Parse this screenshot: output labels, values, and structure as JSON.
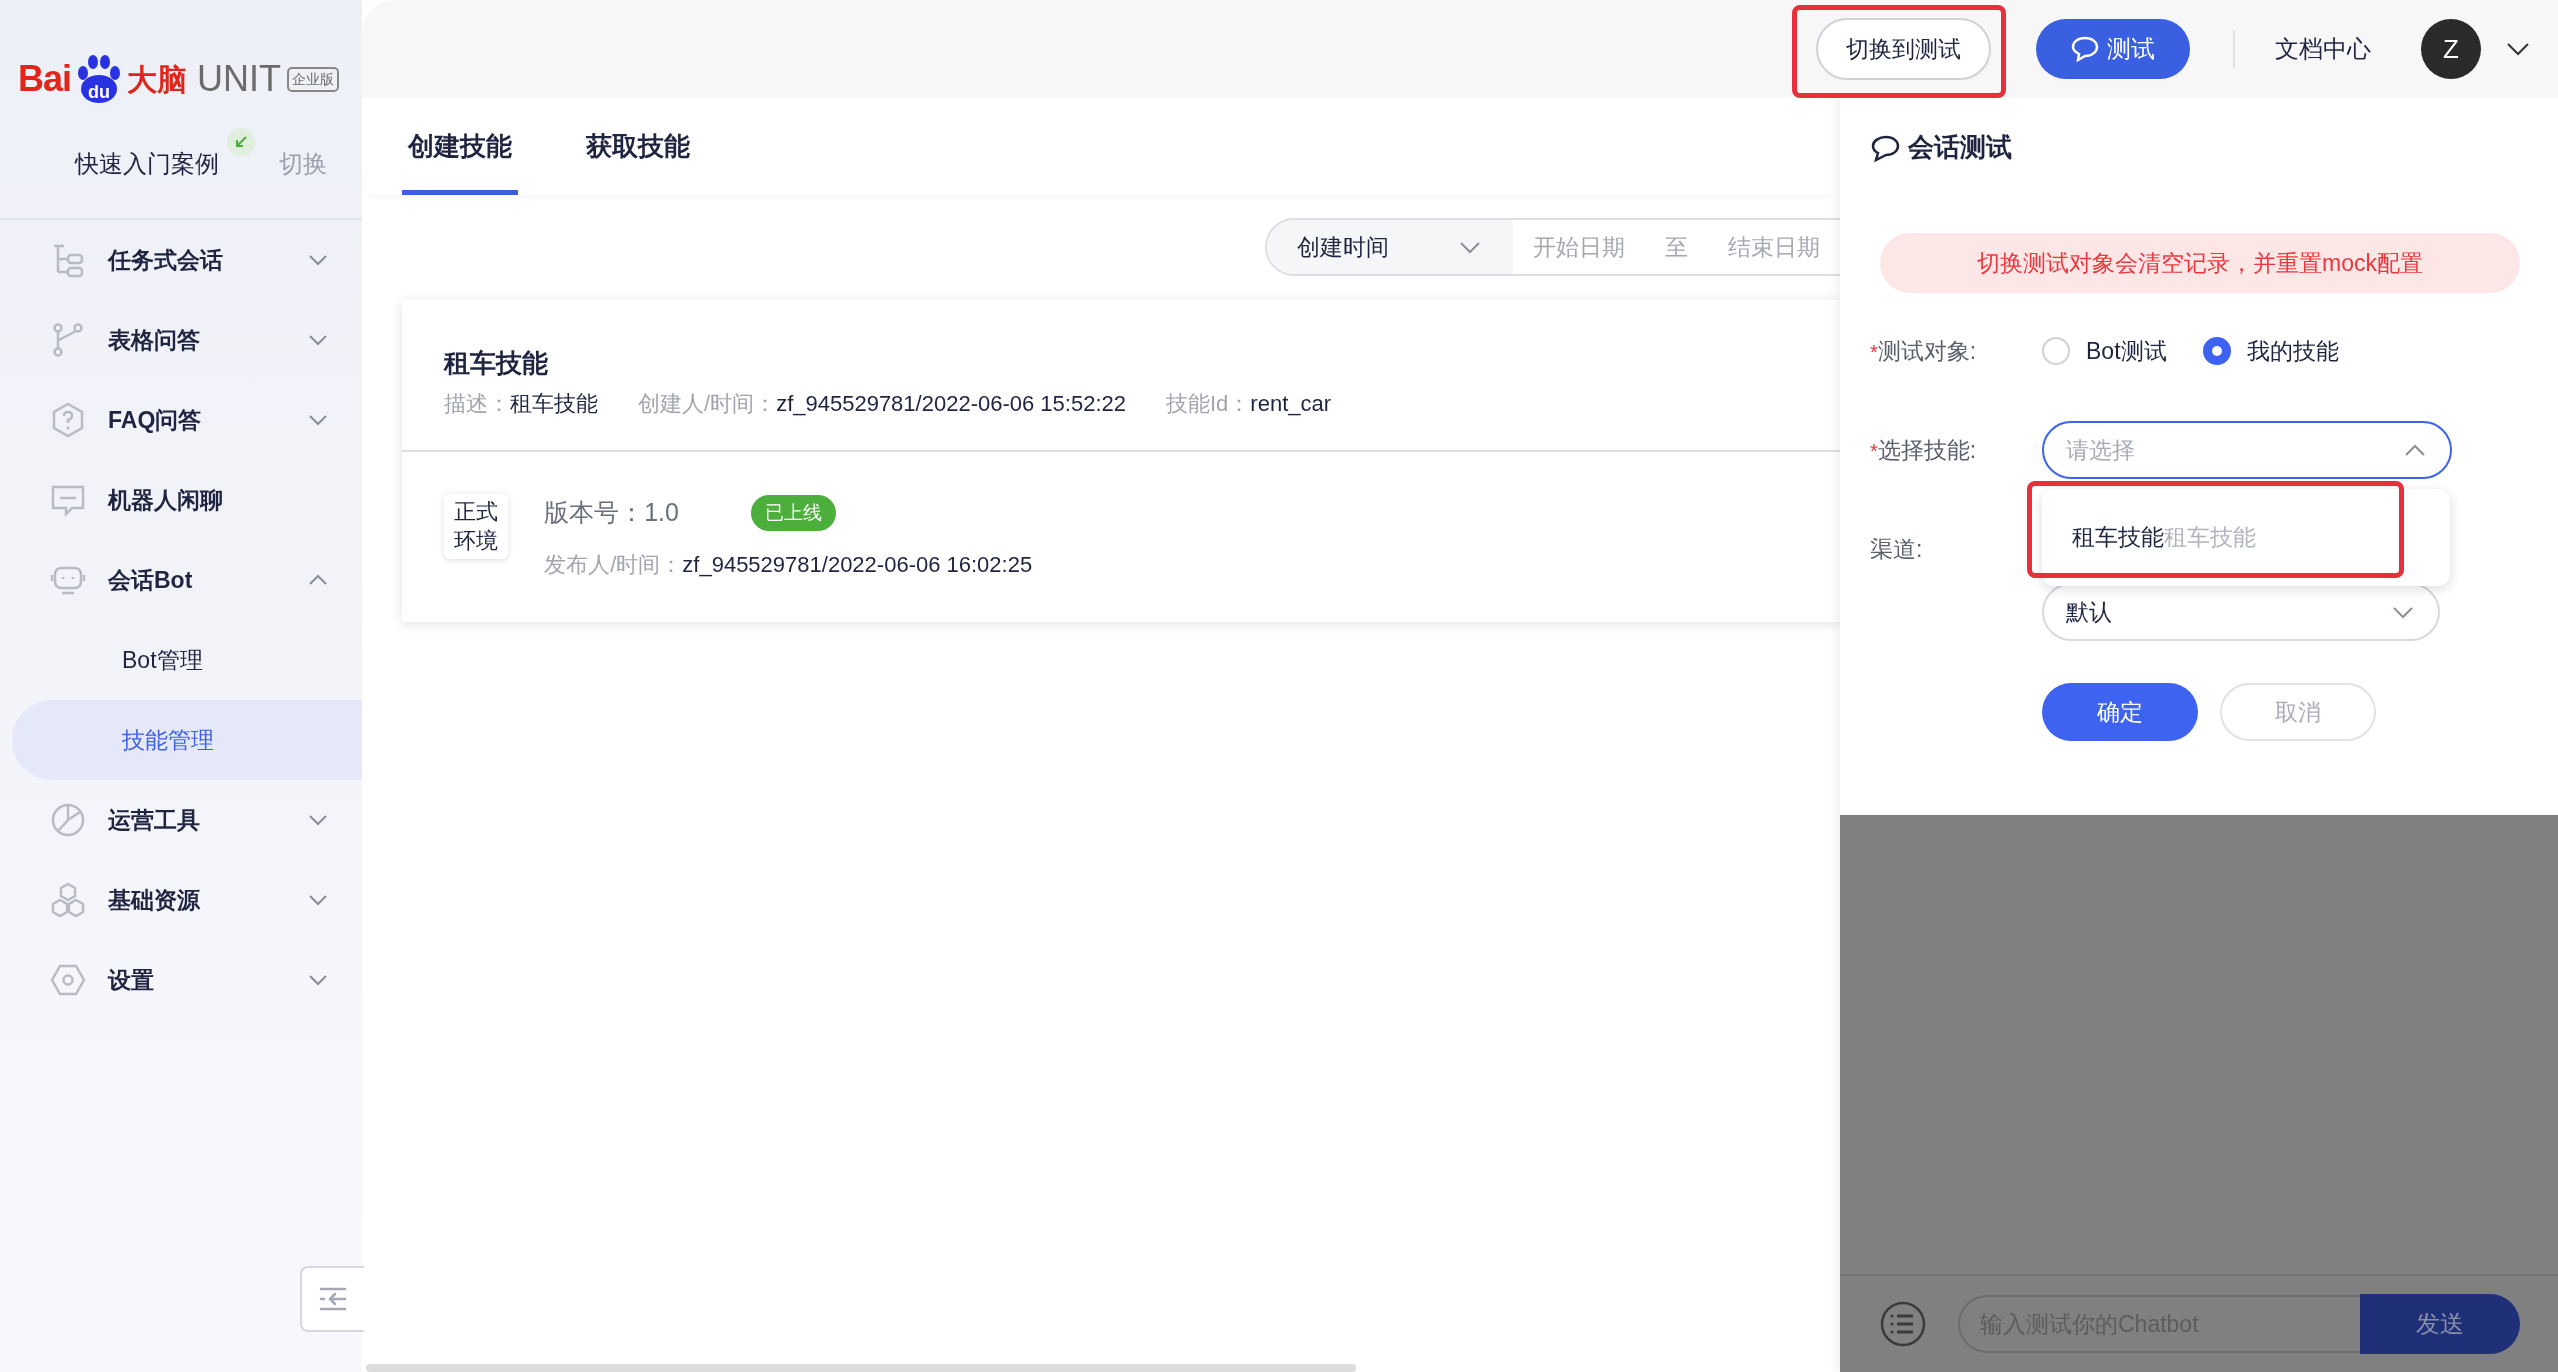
{
  "logo": {
    "bai": "Bai",
    "du": "du",
    "dana": "大脑",
    "unit": "UNIT",
    "edition": "企业版"
  },
  "quickstart": {
    "label": "快速入门案例",
    "switch": "切换"
  },
  "sidebar": {
    "items": [
      {
        "label": "任务式会话",
        "expanded": false
      },
      {
        "label": "表格问答",
        "expanded": false
      },
      {
        "label": "FAQ问答",
        "expanded": false
      },
      {
        "label": "机器人闲聊"
      },
      {
        "label": "会话Bot",
        "expanded": true,
        "children": [
          {
            "label": "Bot管理",
            "selected": false
          },
          {
            "label": "技能管理",
            "selected": true
          }
        ]
      },
      {
        "label": "运营工具",
        "expanded": false
      },
      {
        "label": "基础资源",
        "expanded": false
      },
      {
        "label": "设置",
        "expanded": false
      }
    ]
  },
  "header": {
    "switch_button": {
      "label": "切换到测试",
      "highlighted": true
    },
    "test_button": "测试",
    "docs": "文档中心",
    "avatar": "Z"
  },
  "tabs": [
    {
      "label": "创建技能",
      "selected": true
    },
    {
      "label": "获取技能",
      "selected": false
    }
  ],
  "filter": {
    "sort": "创建时间",
    "start_placeholder": "开始日期",
    "separator": "至",
    "end_placeholder": "结束日期"
  },
  "skill_card": {
    "title": "租车技能",
    "meta": [
      {
        "label": "描述：",
        "value": "租车技能"
      },
      {
        "label": "创建人/时间：",
        "value": "zf_945529781/2022-06-06 15:52:22"
      },
      {
        "label": "技能Id：",
        "value": "rent_car"
      }
    ],
    "version": {
      "env": "正式环境",
      "version_label": "版本号：",
      "version": "1.0",
      "status": "已上线",
      "publisher_label": "发布人/时间：",
      "publisher": "zf_945529781/2022-06-06 16:02:25"
    }
  },
  "test_panel": {
    "title": "会话测试",
    "notice": "切换测试对象会清空记录，并重置mock配置",
    "target": {
      "marker": "*",
      "label": "测试对象:",
      "options": [
        {
          "label": "Bot测试",
          "selected": false
        },
        {
          "label": "我的技能",
          "selected": true
        }
      ]
    },
    "skill": {
      "marker": "*",
      "label": "选择技能:",
      "placeholder": "请选择",
      "expanded": true,
      "options": [
        {
          "name": "租车技能",
          "description": "租车技能",
          "highlighted": true
        }
      ]
    },
    "channel": {
      "label": "渠道:",
      "value": "默认"
    },
    "buttons": [
      {
        "label": "确定",
        "kind": "primary"
      },
      {
        "label": "取消",
        "kind": "secondary"
      }
    ],
    "chat": {
      "placeholder": "输入测试你的Chatbot",
      "send": "发送"
    }
  }
}
